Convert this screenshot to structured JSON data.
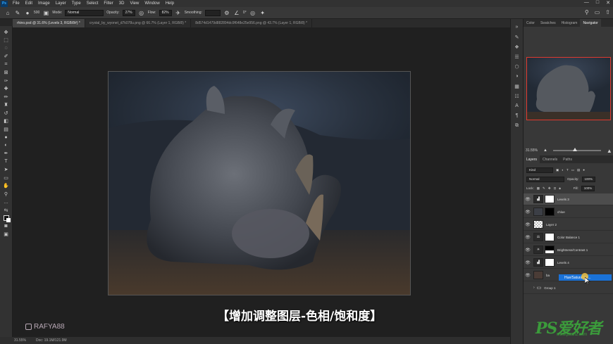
{
  "menubar": {
    "app_icon": "Ps",
    "items": [
      "File",
      "Edit",
      "Image",
      "Layer",
      "Type",
      "Select",
      "Filter",
      "3D",
      "View",
      "Window",
      "Help"
    ],
    "window_controls": [
      "—",
      "□",
      "✕"
    ]
  },
  "options": {
    "brush_size": "500",
    "mode_label": "Mode:",
    "mode_value": "Normal",
    "opacity_label": "Opacity:",
    "opacity_value": "27%",
    "flow_label": "Flow:",
    "flow_value": "82%",
    "smoothing_label": "Smoothing:",
    "angle_value": "0°"
  },
  "tabs": [
    {
      "label": "rhino.psd @ 31.6% (Levels 3, RGB/8#) *",
      "active": true
    },
    {
      "label": "crystal_by_wyonet_d7k078u.png @ 66.7% (Layer 1, RGB/8) *",
      "active": false
    },
    {
      "label": "8d574d1479d882894dc9f648e25e956.png @ 43.7% (Layer 1, RGB/8) *",
      "active": false
    }
  ],
  "overlay": {
    "subtitle": "【增加调整图层-色相/饱和度】",
    "watermark": "RAFYA88"
  },
  "status": {
    "zoom": "31.55%",
    "doc": "Doc: 19.1M/121.9M"
  },
  "right_panel": {
    "tabs": [
      "Color",
      "Swatches",
      "Histogram",
      "Navigator"
    ],
    "active_tab": "Navigator",
    "zoom": "31.55%",
    "layers_tabs": [
      "Layers",
      "Channels",
      "Paths"
    ],
    "kind_label": "Kind",
    "blend_mode": "Normal",
    "opacity_label": "Opacity:",
    "opacity_value": "100%",
    "lock_label": "Lock:",
    "fill_label": "Fill:",
    "fill_value": "100%",
    "layers": [
      {
        "name": "Levels 3",
        "selected": true
      },
      {
        "name": "chloe",
        "selected": false
      },
      {
        "name": "Layer 2",
        "selected": false
      },
      {
        "name": "Color Balance 1",
        "selected": false
      },
      {
        "name": "Brightness/Contrast 1",
        "selected": false
      },
      {
        "name": "Levels 4",
        "selected": false
      },
      {
        "name": "ba",
        "selected": false
      },
      {
        "name": "Group 1",
        "selected": false
      }
    ]
  },
  "context_menu": {
    "item": "Hue/Saturation..."
  },
  "site_watermark": {
    "logo": "PS爱好者",
    "url": "www.psahz.com"
  }
}
